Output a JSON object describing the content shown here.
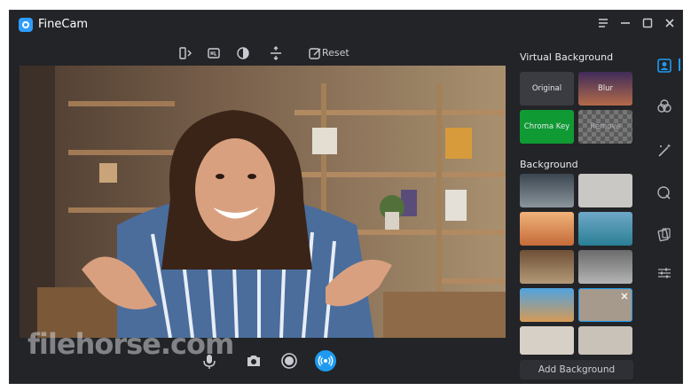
{
  "window": {
    "title": "FineCam",
    "controls": [
      "menu-icon",
      "minimize-icon",
      "maximize-icon",
      "close-icon"
    ]
  },
  "toolbar": {
    "icons": [
      "mirror-icon",
      "hdr-icon",
      "contrast-icon",
      "flip-icon",
      "reset-icon"
    ],
    "reset_label": "Reset"
  },
  "watermark": "filehorse.com",
  "bottombar": {
    "icons": [
      "microphone-icon",
      "camera-icon",
      "record-icon",
      "broadcast-icon"
    ],
    "active_color": "#1e9bf0"
  },
  "panel": {
    "virtual_title": "Virtual Background",
    "virtual_tiles": [
      {
        "label": "Original",
        "color": "#3a3c41"
      },
      {
        "label": "Blur",
        "color": "#7a5a86"
      },
      {
        "label": "Chroma Key",
        "color": "#0f9a34"
      },
      {
        "label": "Remove",
        "color": "#6b6b6b"
      }
    ],
    "background_title": "Background",
    "add_label": "Add Background"
  },
  "side": {
    "icons": [
      "portrait-icon",
      "filter-icon",
      "magic-wand-icon",
      "sticker-icon",
      "scene-icon",
      "adjust-icon"
    ]
  },
  "colors": {
    "accent": "#1e9bf0",
    "panel": "#232427"
  }
}
